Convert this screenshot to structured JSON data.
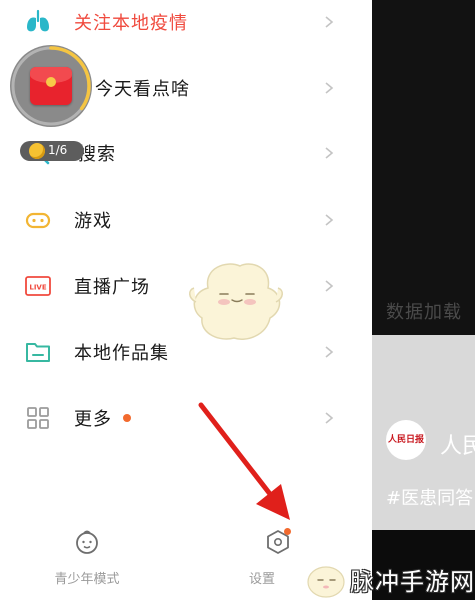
{
  "colors": {
    "accent_red": "#f04a3e",
    "icon_blue": "#2ab7c9",
    "icon_yellow": "#f2b533",
    "icon_green": "#37b8a1",
    "icon_gray": "#9b9b9b",
    "badge_orange": "#f26a2e"
  },
  "menu": {
    "items": [
      {
        "label": "关注本地疫情",
        "icon": "lungs-icon",
        "highlight": true
      },
      {
        "label": "今天看点啥",
        "icon": "red-packet-icon"
      },
      {
        "label": "搜索",
        "icon": "search-icon"
      },
      {
        "label": "游戏",
        "icon": "gamepad-icon"
      },
      {
        "label": "直播广场",
        "icon": "live-icon",
        "icon_text": "LIVE"
      },
      {
        "label": "本地作品集",
        "icon": "folder-icon"
      },
      {
        "label": "更多",
        "icon": "grid-icon",
        "has_badge": true
      }
    ]
  },
  "redpack_widget": {
    "count_text": "1/6",
    "progress": 0.35
  },
  "bottom_bar": {
    "youth_mode_label": "青少年模式",
    "settings_label": "设置"
  },
  "background_video": {
    "account_name": "人民",
    "tag_text": "#医患同答",
    "logo_text": "人民日报",
    "dim_text": "数据加载"
  },
  "watermark": {
    "text": "脉冲手游网"
  }
}
